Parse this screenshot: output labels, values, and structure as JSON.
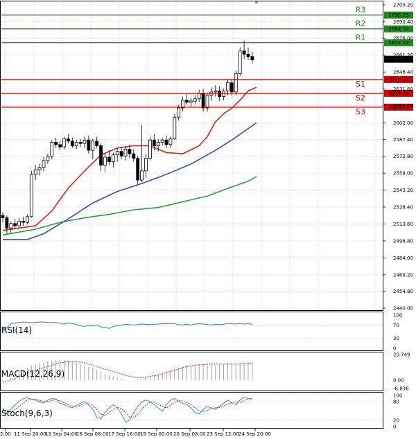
{
  "chart_data": {
    "type": "candlestick",
    "x_labels": [
      "2:00",
      "11 Sep 20:00",
      "13 Sep 04:00",
      "16 Sep 08:00",
      "17 Sep 16:00",
      "19 Sep 00:00",
      "20 Sep 08:00",
      "23 Sep 12:00",
      "24 Sep 20:00"
    ],
    "price_ticks": [
      "2705.20",
      "2690.40",
      "2676.00",
      "2661.20",
      "2646.40",
      "2631.60",
      "2617.20",
      "2602.00",
      "2587.40",
      "2572.80",
      "2558.00",
      "2543.20",
      "2528.40",
      "2513.60",
      "2498.80",
      "2484.00",
      "2469.20",
      "2454.80",
      "2440.00"
    ],
    "ylim": [
      2440.0,
      2705.2
    ],
    "current_price": "2657.60",
    "levels": [
      {
        "name": "R3",
        "value": 2696.29,
        "label": "2696.29",
        "color": "#1b8a1b"
      },
      {
        "name": "R2",
        "value": 2684.2,
        "label": "2684.20",
        "color": "#1b8a1b"
      },
      {
        "name": "R1",
        "value": 2672.12,
        "label": "2672.12",
        "color": "#1b8a1b"
      },
      {
        "name": "S1",
        "value": 2639.88,
        "label": "2639.88",
        "color": "#d40000"
      },
      {
        "name": "S2",
        "value": 2627.8,
        "label": "2627.80",
        "color": "#d40000"
      },
      {
        "name": "S3",
        "value": 2615.71,
        "label": "2615.71",
        "color": "#d40000"
      }
    ],
    "candles": [
      [
        2521,
        2524,
        2515,
        2519
      ],
      [
        2519,
        2521,
        2505,
        2510
      ],
      [
        2510,
        2516,
        2506,
        2514
      ],
      [
        2514,
        2518,
        2509,
        2512
      ],
      [
        2512,
        2519,
        2510,
        2516
      ],
      [
        2516,
        2520,
        2512,
        2515
      ],
      [
        2515,
        2522,
        2513,
        2520
      ],
      [
        2520,
        2560,
        2519,
        2557
      ],
      [
        2557,
        2565,
        2552,
        2561
      ],
      [
        2561,
        2566,
        2556,
        2563
      ],
      [
        2563,
        2572,
        2560,
        2569
      ],
      [
        2569,
        2575,
        2566,
        2573
      ],
      [
        2573,
        2587,
        2570,
        2585
      ],
      [
        2585,
        2589,
        2580,
        2583
      ],
      [
        2583,
        2586,
        2578,
        2581
      ],
      [
        2581,
        2590,
        2579,
        2588
      ],
      [
        2588,
        2592,
        2584,
        2586
      ],
      [
        2586,
        2589,
        2580,
        2582
      ],
      [
        2582,
        2587,
        2579,
        2585
      ],
      [
        2585,
        2588,
        2581,
        2584
      ],
      [
        2584,
        2590,
        2580,
        2587
      ],
      [
        2587,
        2591,
        2575,
        2578
      ],
      [
        2578,
        2588,
        2570,
        2586
      ],
      [
        2586,
        2590,
        2580,
        2582
      ],
      [
        2582,
        2584,
        2560,
        2565
      ],
      [
        2565,
        2576,
        2559,
        2572
      ],
      [
        2572,
        2578,
        2565,
        2568
      ],
      [
        2568,
        2576,
        2563,
        2574
      ],
      [
        2574,
        2580,
        2568,
        2577
      ],
      [
        2577,
        2581,
        2570,
        2573
      ],
      [
        2573,
        2582,
        2569,
        2579
      ],
      [
        2579,
        2583,
        2571,
        2575
      ],
      [
        2575,
        2579,
        2568,
        2571
      ],
      [
        2571,
        2573,
        2548,
        2552
      ],
      [
        2552,
        2600,
        2550,
        2560
      ],
      [
        2560,
        2575,
        2554,
        2571
      ],
      [
        2571,
        2590,
        2569,
        2587
      ],
      [
        2587,
        2592,
        2578,
        2582
      ],
      [
        2582,
        2588,
        2577,
        2585
      ],
      [
        2585,
        2589,
        2582,
        2587
      ],
      [
        2587,
        2591,
        2580,
        2583
      ],
      [
        2583,
        2590,
        2580,
        2588
      ],
      [
        2588,
        2610,
        2587,
        2607
      ],
      [
        2607,
        2618,
        2604,
        2615
      ],
      [
        2615,
        2625,
        2612,
        2622
      ],
      [
        2622,
        2627,
        2618,
        2620
      ],
      [
        2620,
        2624,
        2616,
        2621
      ],
      [
        2621,
        2626,
        2618,
        2623
      ],
      [
        2623,
        2631,
        2620,
        2628
      ],
      [
        2628,
        2632,
        2612,
        2615
      ],
      [
        2615,
        2628,
        2612,
        2626
      ],
      [
        2626,
        2633,
        2621,
        2629
      ],
      [
        2629,
        2635,
        2625,
        2630
      ],
      [
        2630,
        2634,
        2621,
        2625
      ],
      [
        2625,
        2632,
        2622,
        2630
      ],
      [
        2630,
        2640,
        2626,
        2637
      ],
      [
        2637,
        2640,
        2626,
        2629
      ],
      [
        2629,
        2648,
        2626,
        2645
      ],
      [
        2645,
        2668,
        2643,
        2665
      ],
      [
        2665,
        2674,
        2658,
        2662
      ],
      [
        2662,
        2668,
        2657,
        2660
      ],
      [
        2660,
        2664,
        2654,
        2657
      ]
    ],
    "ma_fast": [
      [
        0,
        2508
      ],
      [
        8,
        2512
      ],
      [
        12,
        2525
      ],
      [
        16,
        2545
      ],
      [
        20,
        2560
      ],
      [
        24,
        2574
      ],
      [
        28,
        2580
      ],
      [
        32,
        2582
      ],
      [
        36,
        2582
      ],
      [
        40,
        2576
      ],
      [
        44,
        2575
      ],
      [
        48,
        2582
      ],
      [
        50,
        2590
      ],
      [
        52,
        2603
      ],
      [
        54,
        2610
      ],
      [
        56,
        2615
      ],
      [
        58,
        2622
      ],
      [
        60,
        2630
      ],
      [
        62,
        2633
      ]
    ],
    "ma_mid": [
      [
        0,
        2500
      ],
      [
        6,
        2500
      ],
      [
        10,
        2505
      ],
      [
        16,
        2518
      ],
      [
        22,
        2532
      ],
      [
        28,
        2542
      ],
      [
        34,
        2549
      ],
      [
        40,
        2557
      ],
      [
        46,
        2566
      ],
      [
        52,
        2578
      ],
      [
        56,
        2587
      ],
      [
        60,
        2597
      ],
      [
        62,
        2602
      ]
    ],
    "ma_slow": [
      [
        0,
        2504
      ],
      [
        8,
        2509
      ],
      [
        14,
        2515
      ],
      [
        20,
        2519
      ],
      [
        26,
        2522
      ],
      [
        32,
        2526
      ],
      [
        38,
        2528
      ],
      [
        44,
        2533
      ],
      [
        50,
        2538
      ],
      [
        56,
        2546
      ],
      [
        60,
        2551
      ],
      [
        62,
        2555
      ]
    ],
    "rsi": {
      "label": "RSI(14)",
      "ticks": [
        "100",
        "70",
        "30",
        "0"
      ],
      "ylim": [
        0,
        100
      ],
      "values": [
        58,
        62,
        74,
        76,
        78,
        79,
        78,
        77,
        78,
        79,
        79,
        78,
        77,
        78,
        75,
        73,
        76,
        74,
        72,
        67,
        66,
        69,
        67,
        70,
        64,
        63,
        60,
        66,
        68,
        70,
        72,
        71,
        70,
        71,
        73,
        72,
        71,
        72,
        73,
        74,
        74,
        75,
        74,
        71,
        70,
        72,
        70,
        73,
        74,
        73,
        71,
        70,
        72,
        71,
        72,
        75,
        74,
        73,
        75,
        73,
        74,
        72
      ]
    },
    "macd": {
      "label": "MACD(12,26,9)",
      "ticks": [
        "20.749",
        "0.00",
        "-6.836"
      ],
      "ylim": [
        -6.836,
        20.749
      ],
      "bars": [
        -1,
        0,
        2,
        4,
        6,
        8,
        10,
        12,
        13,
        14,
        15,
        15.5,
        16,
        16.5,
        16.5,
        16,
        15.5,
        15,
        14,
        13,
        12,
        11,
        10,
        8,
        7,
        5,
        4,
        3,
        2,
        1,
        0.5,
        0,
        0,
        0.5,
        1,
        2,
        3,
        4,
        5,
        6,
        7,
        8,
        9,
        10,
        11,
        12,
        12.5,
        13,
        13,
        13,
        13,
        13,
        12.5,
        12.5,
        12.5,
        13,
        13,
        13,
        13.5,
        14,
        14.5,
        15
      ],
      "signal": [
        -2,
        -1,
        0,
        1,
        3,
        4,
        6,
        7,
        8,
        9,
        10,
        11,
        12,
        13,
        14,
        14.5,
        15,
        15,
        15,
        14.5,
        14,
        13,
        12,
        11,
        10,
        9,
        8,
        7,
        6,
        5,
        4,
        3,
        2.5,
        2,
        2,
        2.5,
        3,
        3.5,
        4,
        5,
        6,
        7,
        8,
        9,
        10,
        11,
        11.5,
        12,
        12.5,
        12.5,
        13,
        13,
        13,
        13,
        13,
        13,
        13,
        13,
        13,
        13.5,
        13.5,
        14
      ]
    },
    "stoch": {
      "label": "Stoch(9,6,3)",
      "ticks": [
        "100",
        "80",
        "20",
        "0"
      ],
      "ylim": [
        0,
        100
      ],
      "k": [
        60,
        40,
        55,
        70,
        80,
        90,
        92,
        88,
        85,
        80,
        75,
        85,
        90,
        88,
        75,
        70,
        65,
        60,
        68,
        75,
        80,
        70,
        55,
        30,
        25,
        45,
        60,
        70,
        60,
        40,
        15,
        20,
        45,
        65,
        80,
        85,
        80,
        70,
        60,
        50,
        70,
        85,
        90,
        80,
        75,
        70,
        60,
        45,
        40,
        55,
        65,
        60,
        55,
        65,
        75,
        85,
        75,
        70,
        85,
        95,
        90,
        88
      ],
      "d": [
        55,
        50,
        48,
        55,
        65,
        75,
        85,
        88,
        88,
        84,
        80,
        80,
        84,
        86,
        82,
        76,
        70,
        65,
        64,
        68,
        73,
        74,
        68,
        55,
        40,
        35,
        45,
        55,
        62,
        58,
        45,
        30,
        28,
        40,
        55,
        70,
        78,
        78,
        72,
        65,
        60,
        68,
        78,
        84,
        82,
        77,
        70,
        60,
        50,
        48,
        52,
        58,
        60,
        62,
        66,
        72,
        78,
        78,
        78,
        84,
        89,
        90
      ]
    }
  }
}
